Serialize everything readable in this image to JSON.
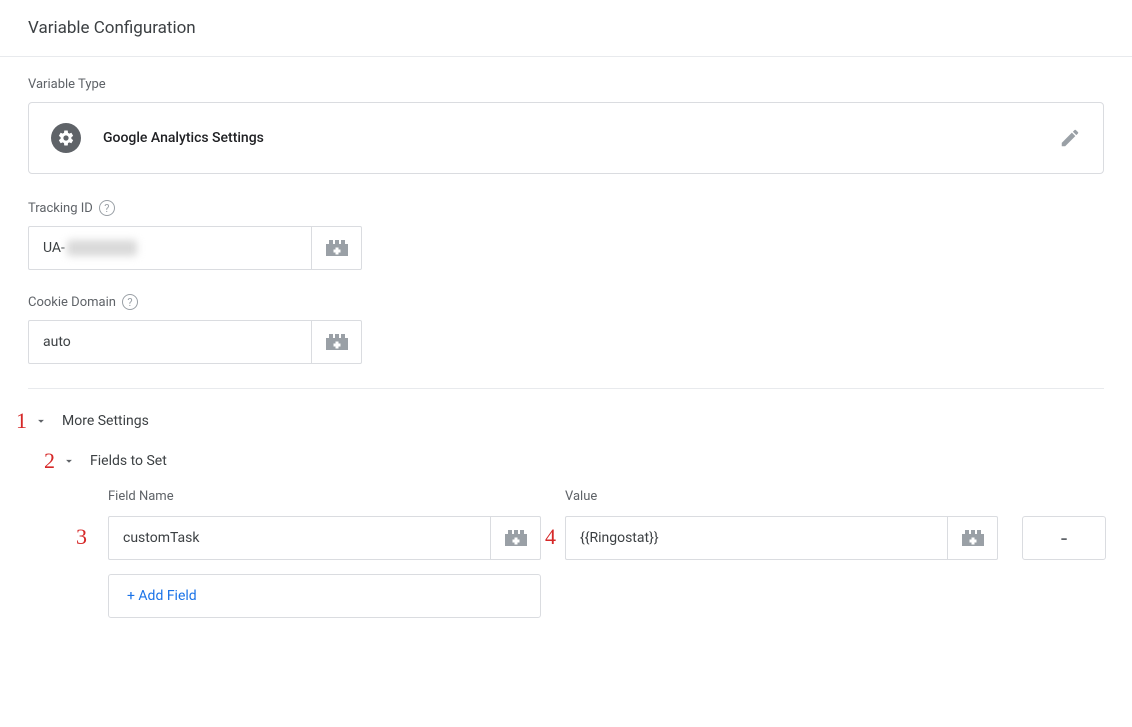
{
  "header": {
    "title": "Variable Configuration"
  },
  "variable_type": {
    "label": "Variable Type",
    "name": "Google Analytics Settings"
  },
  "tracking_id": {
    "label": "Tracking ID",
    "value_prefix": "UA-"
  },
  "cookie_domain": {
    "label": "Cookie Domain",
    "value": "auto"
  },
  "more_settings": {
    "label": "More Settings",
    "fields_to_set": {
      "label": "Fields to Set",
      "columns": {
        "field_name": "Field Name",
        "value": "Value"
      },
      "rows": [
        {
          "field_name": "customTask",
          "value": "{{Ringostat}}"
        }
      ],
      "add_button": "+ Add Field",
      "remove_button": "-"
    }
  },
  "annotations": {
    "a1": "1",
    "a2": "2",
    "a3": "3",
    "a4": "4"
  }
}
